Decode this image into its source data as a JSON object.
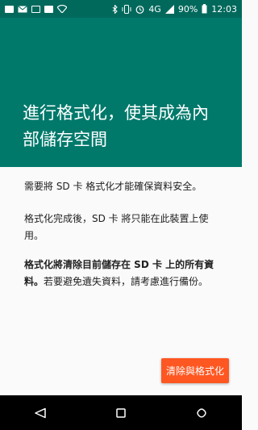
{
  "status_bar": {
    "battery": "90%",
    "time": "12:03",
    "network": "4G"
  },
  "header": {
    "title": "進行格式化，使其成為內部儲存空間"
  },
  "content": {
    "paragraph1": "需要將 SD 卡 格式化才能確保資料安全。",
    "paragraph2": "格式化完成後，SD 卡 將只能在此裝置上使用。",
    "paragraph3_bold": "格式化將清除目前儲存在 SD 卡 上的所有資料。",
    "paragraph3_rest": "若要避免遺失資料，請考慮進行備份。"
  },
  "action_button": {
    "label": "清除與格式化"
  },
  "colors": {
    "header": "#00796b",
    "status_bar": "#00695c",
    "accent": "#ff5722"
  },
  "nav_icons": [
    "back-icon",
    "home-icon",
    "recents-icon"
  ]
}
